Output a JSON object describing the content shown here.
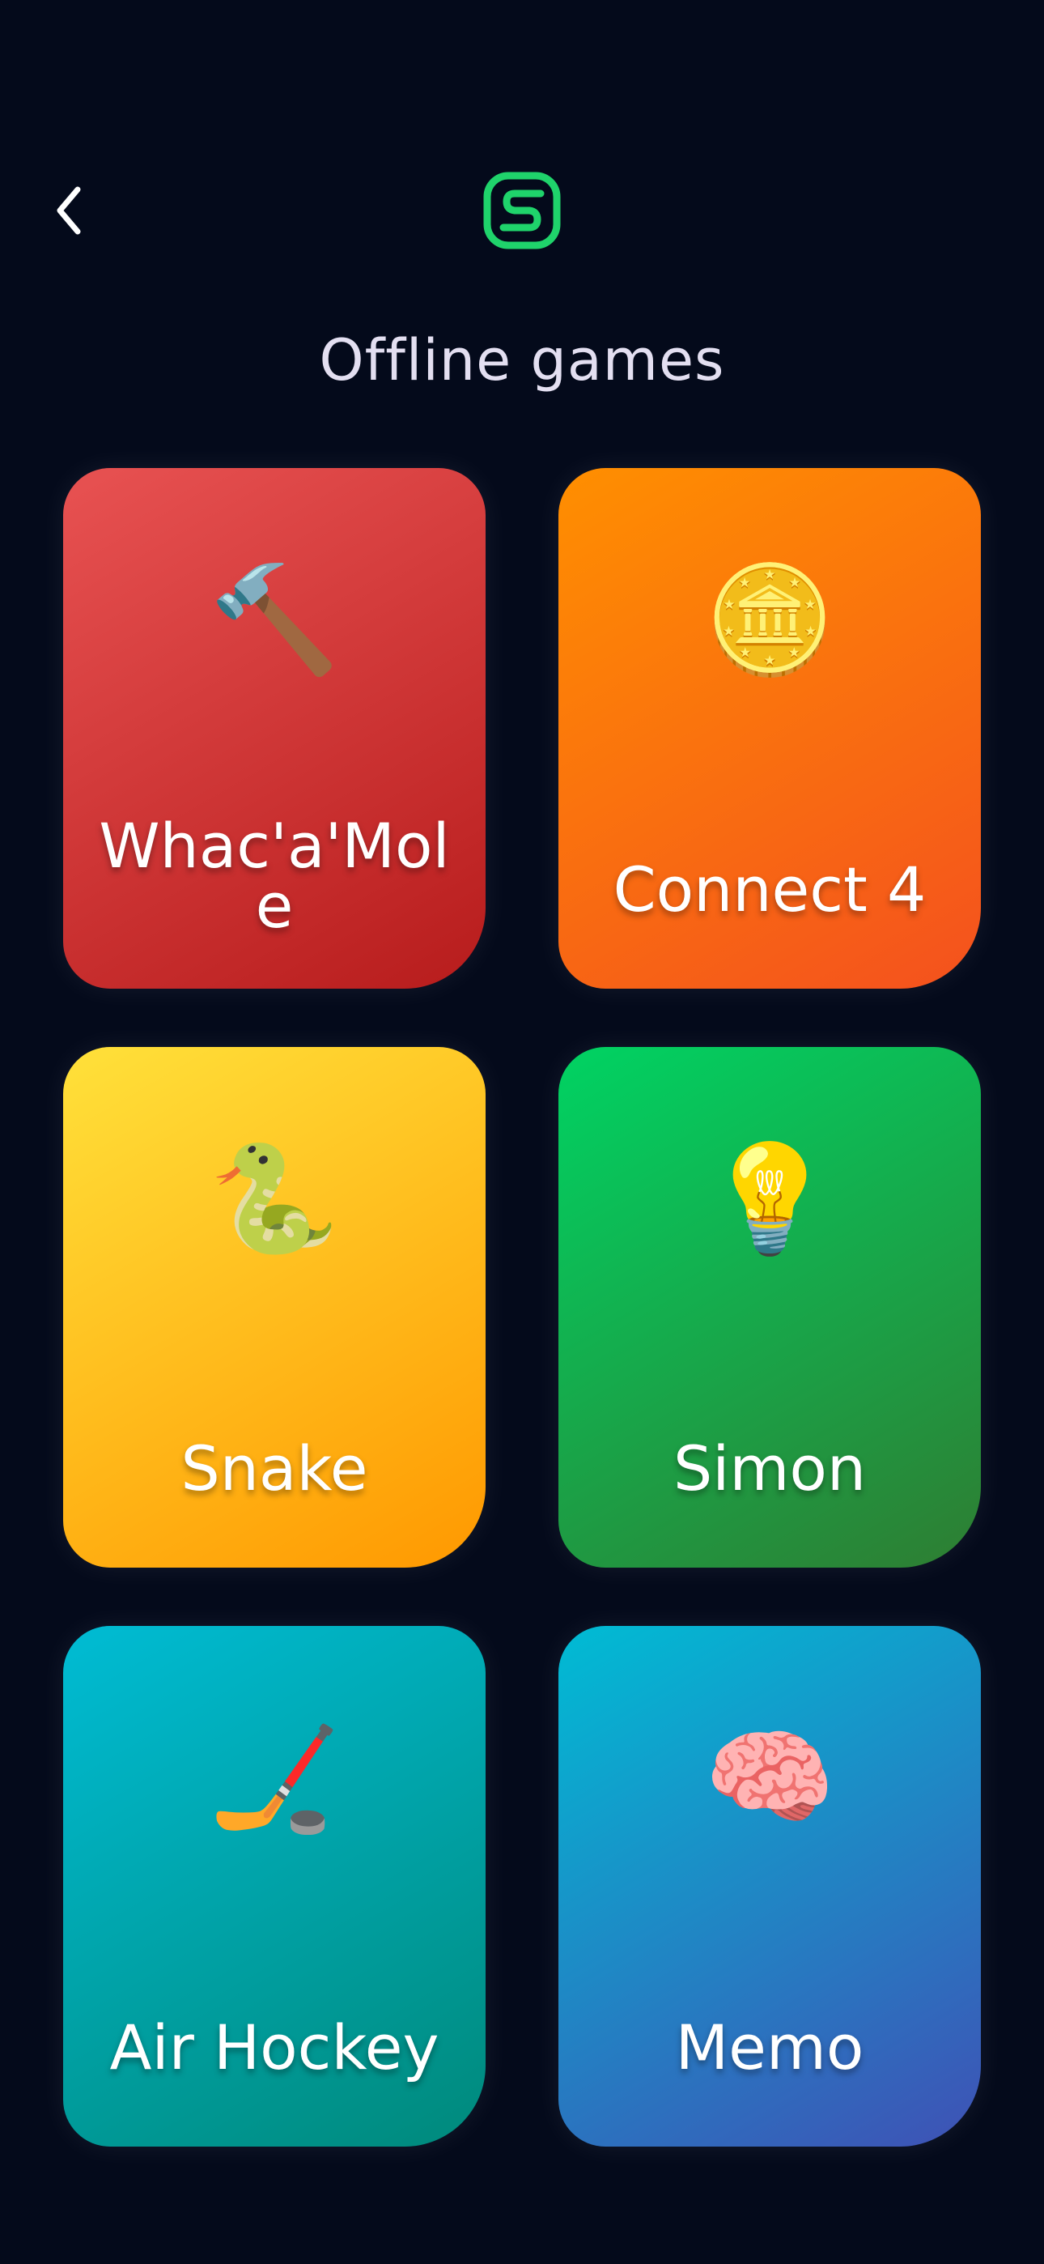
{
  "header": {
    "back_icon": "chevron-left-icon",
    "logo_icon": "app-logo-icon",
    "accent_color": "#1fd36b"
  },
  "page_title": "Offline games",
  "games": [
    {
      "label": "Whac'a'Mole",
      "emoji": "🔨",
      "icon": "hammer-icon",
      "colors": [
        "#e85252",
        "#b71c1c"
      ]
    },
    {
      "label": "Connect 4",
      "emoji": "🪙",
      "icon": "coin-icon",
      "colors": [
        "#ff8f00",
        "#f4511e"
      ]
    },
    {
      "label": "Snake",
      "emoji": "🐍",
      "icon": "snake-icon",
      "colors": [
        "#ffe13a",
        "#ff9800"
      ]
    },
    {
      "label": "Simon",
      "emoji": "💡",
      "icon": "lightbulb-icon",
      "colors": [
        "#00d363",
        "#2e7d32"
      ]
    },
    {
      "label": "Air Hockey",
      "emoji": "🏒",
      "icon": "hockey-stick-icon",
      "colors": [
        "#00bcd4",
        "#00897b"
      ]
    },
    {
      "label": "Memo",
      "emoji": "🧠",
      "icon": "brain-icon",
      "colors": [
        "#00bcd4",
        "#3f51b5"
      ]
    }
  ]
}
